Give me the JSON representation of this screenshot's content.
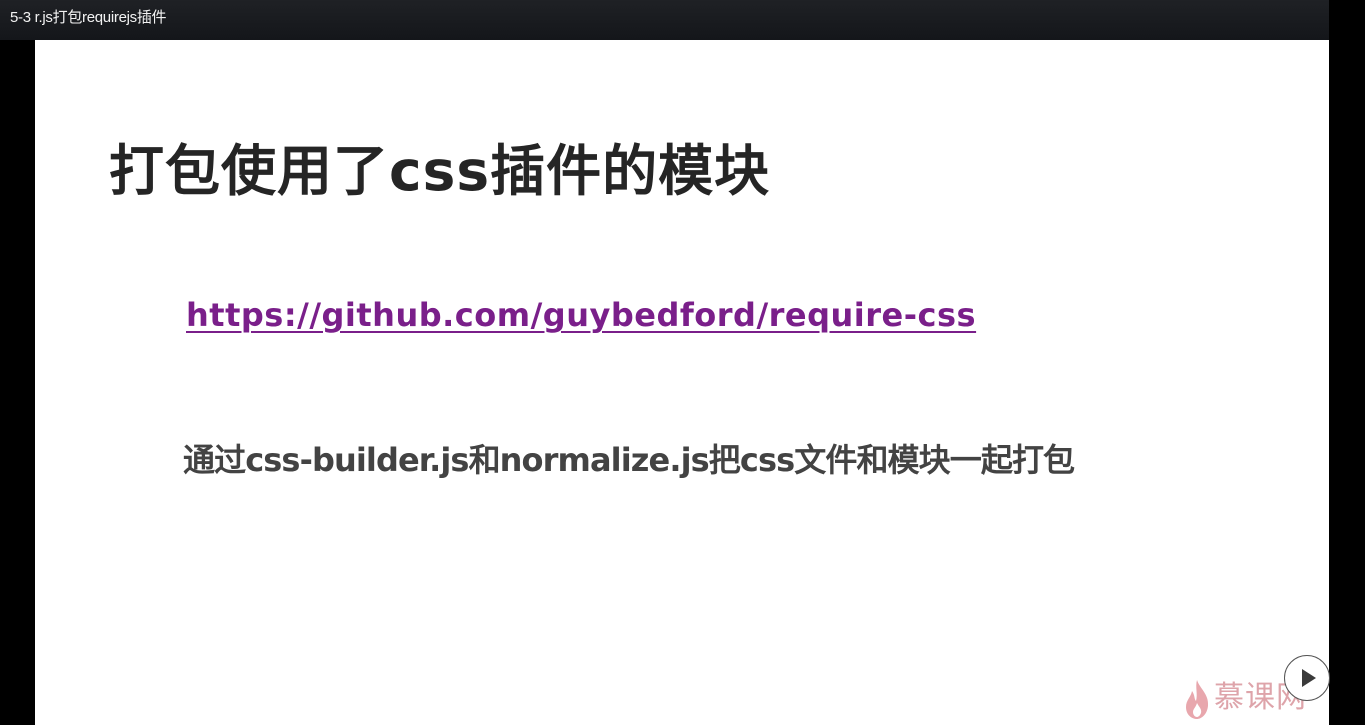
{
  "window": {
    "title": "5-3 r.js打包requirejs插件"
  },
  "slide": {
    "heading": "打包使用了css插件的模块",
    "link_text": "https://github.com/guybedford/require-css",
    "body_text": "通过css-builder.js和normalize.js把css文件和模块一起打包"
  },
  "player": {
    "play_icon": "play-icon"
  },
  "watermark": {
    "logo_icon": "flame-icon",
    "text": "慕课网"
  },
  "colors": {
    "title_bar": "#1f2125",
    "slide_background": "#ffffff",
    "heading": "#252525",
    "link": "#7a1f8a",
    "body": "#434343",
    "watermark": "#c45b66"
  }
}
